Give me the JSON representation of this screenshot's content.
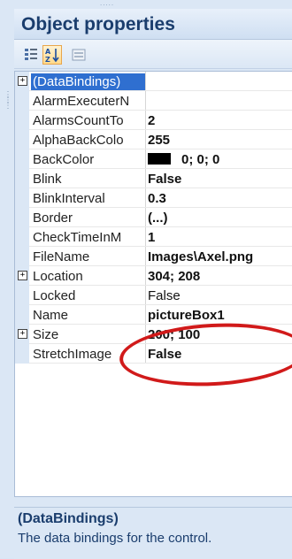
{
  "header": {
    "title": "Object properties"
  },
  "toolbar": {
    "buttons": [
      "categorized-icon",
      "alphabetical-icon",
      "property-pages-icon"
    ],
    "active": "alphabetical-icon"
  },
  "properties": [
    {
      "name": "(DataBindings)",
      "value": "",
      "expandable": true,
      "selected": true,
      "bold": false
    },
    {
      "name": "AlarmExecuterN",
      "value": "",
      "expandable": false,
      "bold": false
    },
    {
      "name": "AlarmsCountTo",
      "value": "2",
      "expandable": false,
      "bold": true
    },
    {
      "name": "AlphaBackColo",
      "value": "255",
      "expandable": false,
      "bold": true
    },
    {
      "name": "BackColor",
      "value": "0; 0; 0",
      "expandable": false,
      "bold": true,
      "swatch": "#000000"
    },
    {
      "name": "Blink",
      "value": "False",
      "expandable": false,
      "bold": true
    },
    {
      "name": "BlinkInterval",
      "value": "0.3",
      "expandable": false,
      "bold": true
    },
    {
      "name": "Border",
      "value": "(...)",
      "expandable": false,
      "bold": true
    },
    {
      "name": "CheckTimeInM",
      "value": "1",
      "expandable": false,
      "bold": true
    },
    {
      "name": "FileName",
      "value": "Images\\Axel.png",
      "expandable": false,
      "bold": true
    },
    {
      "name": "Location",
      "value": "304; 208",
      "expandable": true,
      "bold": true
    },
    {
      "name": "Locked",
      "value": "False",
      "expandable": false,
      "bold": false
    },
    {
      "name": "Name",
      "value": "pictureBox1",
      "expandable": false,
      "bold": true
    },
    {
      "name": "Size",
      "value": "200; 100",
      "expandable": true,
      "bold": true
    },
    {
      "name": "StretchImage",
      "value": "False",
      "expandable": false,
      "bold": true
    }
  ],
  "description": {
    "title": "(DataBindings)",
    "text": "The data bindings for the control."
  },
  "highlight_color": "#d11a1a"
}
